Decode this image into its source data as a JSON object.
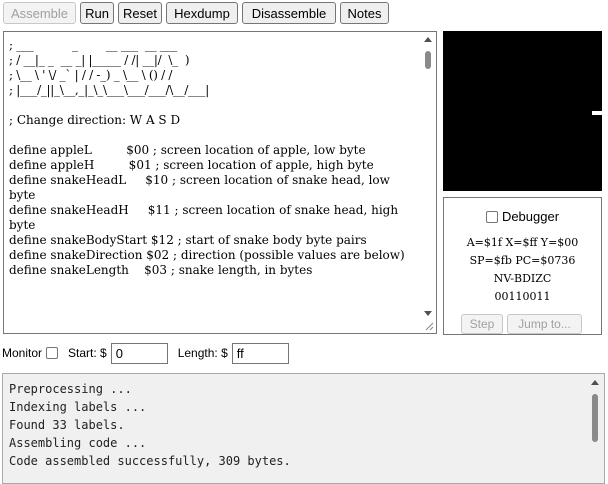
{
  "toolbar": {
    "assemble": "Assemble",
    "run": "Run",
    "reset": "Reset",
    "hexdump": "Hexdump",
    "disassemble": "Disassemble",
    "notes": "Notes"
  },
  "editor": {
    "lines": [
      "; ___           _        __ ___  __ ___",
      "; / __|_ _  __ _| |_____ / /| __|/  \\_  )",
      "; \\__ \\ ' \\/ _` | / / -_) _ \\__ \\ () / /",
      "; |___/_||_\\__,_|_\\_\\___\\___/___/\\__/___|",
      "",
      "; Change direction: W A S D",
      "",
      "define appleL         $00 ; screen location of apple, low byte",
      "define appleH         $01 ; screen location of apple, high byte",
      "define snakeHeadL     $10 ; screen location of snake head, low byte",
      "define snakeHeadH     $11 ; screen location of snake head, high byte",
      "define snakeBodyStart $12 ; start of snake body byte pairs",
      "define snakeDirection $02 ; direction (possible values are below)",
      "define snakeLength    $03 ; snake length, in bytes"
    ]
  },
  "debugger": {
    "label": "Debugger",
    "registers": "A=$1f X=$ff Y=$00",
    "pointers": "SP=$fb PC=$0736",
    "flags_header": "NV-BDIZC",
    "flags_bits": "00110011",
    "step": "Step",
    "jump": "Jump to..."
  },
  "monitor": {
    "label": "Monitor",
    "start_label": "Start: $",
    "start_value": "0",
    "length_label": "Length: $",
    "length_value": "ff"
  },
  "console": {
    "lines": [
      "Preprocessing ...",
      "Indexing labels ...",
      "Found 33 labels.",
      "Assembling code ...",
      "Code assembled successfully, 309 bytes."
    ]
  },
  "colors": {
    "screen_background": "#000000",
    "snake_pixel": "#ffffff",
    "console_background": "#f0f0f0"
  },
  "icons": [
    "scroll-up-arrow-icon",
    "scroll-down-arrow-icon",
    "resize-grip-icon",
    "checkbox-icon"
  ]
}
